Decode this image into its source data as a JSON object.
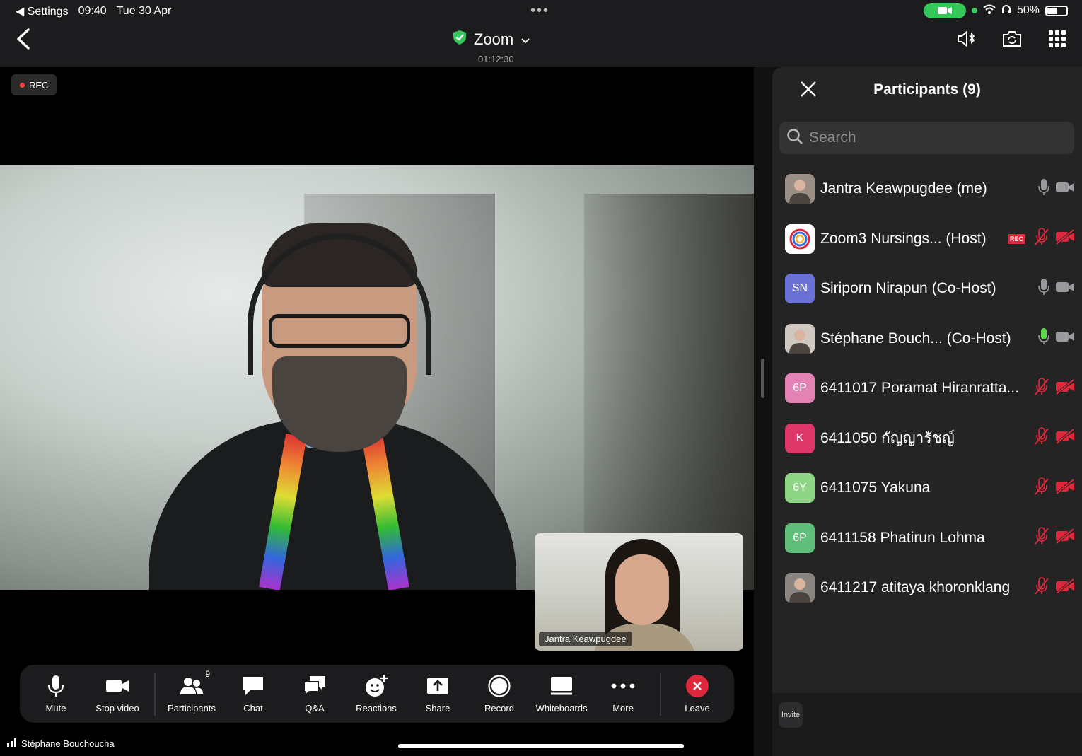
{
  "status_bar": {
    "back_app": "◀ Settings",
    "time": "09:40",
    "date": "Tue 30 Apr",
    "battery": "50%",
    "battery_level": 0.5
  },
  "header": {
    "title": "Zoom",
    "elapsed": "01:12:30"
  },
  "stage": {
    "rec_label": "REC",
    "self_view_name": "Jantra Keawpugdee",
    "active_speaker": "Stéphane Bouchoucha"
  },
  "toolbar": {
    "mute": "Mute",
    "stop_video": "Stop video",
    "participants": "Participants",
    "participants_count": "9",
    "chat": "Chat",
    "qa": "Q&A",
    "reactions": "Reactions",
    "share": "Share",
    "record": "Record",
    "whiteboards": "Whiteboards",
    "more": "More",
    "leave": "Leave"
  },
  "participants_panel": {
    "title": "Participants (9)",
    "search_placeholder": "Search",
    "invite": "Invite",
    "rec_tag": "REC",
    "list": [
      {
        "name": "Jantra Keawpugdee (me)",
        "initials": "",
        "avatar_color": "#9b8f85",
        "mic": "on",
        "video": "on"
      },
      {
        "name": "Zoom3 Nursings...  (Host)",
        "initials": "",
        "avatar_color": "#ffffff",
        "mic": "muted",
        "video": "off",
        "rec": true
      },
      {
        "name": "Siriporn Nirapun (Co-Host)",
        "initials": "SN",
        "avatar_color": "#6a72d8",
        "mic": "on",
        "video": "on"
      },
      {
        "name": "Stéphane Bouch... (Co-Host)",
        "initials": "",
        "avatar_color": "#cfc8c0",
        "mic": "speaking",
        "video": "on"
      },
      {
        "name": "6411017 Poramat Hiranratta...",
        "initials": "6P",
        "avatar_color": "#e383b4",
        "mic": "muted",
        "video": "off"
      },
      {
        "name": "6411050 กัญญารัชญ์",
        "initials": "K",
        "avatar_color": "#e0386a",
        "mic": "muted",
        "video": "off"
      },
      {
        "name": "6411075 Yakuna",
        "initials": "6Y",
        "avatar_color": "#8ed685",
        "mic": "muted",
        "video": "off"
      },
      {
        "name": "6411158 Phatirun Lohma",
        "initials": "6P",
        "avatar_color": "#5fbf7a",
        "mic": "muted",
        "video": "off"
      },
      {
        "name": "6411217 atitaya khoronklang",
        "initials": "",
        "avatar_color": "#8a8580",
        "mic": "muted",
        "video": "off"
      }
    ]
  },
  "colors": {
    "accent_green": "#34c759",
    "muted_red": "#e0283c",
    "panel_bg": "#242424"
  }
}
